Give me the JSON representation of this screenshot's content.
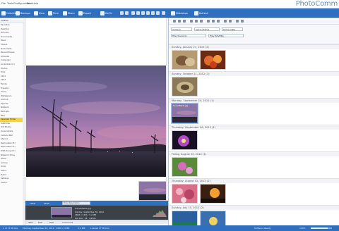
{
  "menubar": {
    "items": [
      "File",
      "Tools",
      "Configuration",
      "Web",
      "Help"
    ],
    "brand": "PhotoComm"
  },
  "toolbar": {
    "buttons": [
      {
        "label": "Collection"
      },
      {
        "label": "Backups"
      },
      {
        "label": "View"
      },
      {
        "label": "Print"
      },
      {
        "label": "Share"
      },
      {
        "label": "Export"
      },
      {
        "label": "Go To"
      },
      {
        "label": "Slideshow"
      },
      {
        "label": "Refresh"
      }
    ]
  },
  "left_panel": {
    "header": "Folders",
    "items": [
      "Favorites",
      "Desktop",
      "Pictures",
      "Documents",
      "Music",
      "Videos",
      "Downloads",
      "Recent Places",
      "Libraries",
      "Computer",
      "Local Disk (C:)",
      "Photos",
      "Trips",
      "2012",
      "2013",
      "Family",
      "Projects",
      "Scans",
      "Wallpapers",
      "Archive",
      "Exports",
      "Network",
      "Backups",
      "Misc",
      "Selected Folder",
      "Subfolder",
      "Old Photos",
      "Screenshots",
      "Camera Roll",
      "Shared",
      "Removable (E:)",
      "Removable (F:)",
      "DVD Drive (D:)",
      "Network Drive",
      "Other",
      "Library",
      "Temp",
      "Users",
      "Public",
      "Settings",
      "Cache"
    ],
    "selected_index": 24
  },
  "viewer": {
    "strip": {
      "title_btn": "TITLE",
      "tags_btn": "TAGS",
      "field_placeholder": "Enter Description"
    },
    "info": {
      "filename": "SunsetFields.jpg",
      "date": "Sunday, September 30, 2012",
      "details": "4608 x 3456  ·  5.2 MB",
      "camera": "ISO 100  ·  f/8  ·  1/250s"
    },
    "tabs": [
      "INFO",
      "EXIF",
      "MAP",
      "Comments"
    ]
  },
  "right_panel": {
    "filters": {
      "type": "All Types",
      "rating": "Sort by Rating",
      "date": "Sort by Date",
      "search": "Filter Keywords",
      "extra": "Filter EPS/JPEG"
    },
    "groups": [
      {
        "date": "Sunday, January 27, 2013",
        "count": "(2)"
      },
      {
        "date": "Sunday, October 21, 2012",
        "count": "(1)"
      },
      {
        "date": "Monday, September 24, 2012",
        "count": "(1)"
      },
      {
        "date": "Thursday, September 06, 2012",
        "count": "(1)"
      },
      {
        "date": "Friday, August 03, 2012",
        "count": "(1)"
      },
      {
        "date": "Thursday, August 02, 2012",
        "count": "(2)"
      },
      {
        "date": "Sunday, July 15, 2012",
        "count": "(2)"
      }
    ],
    "selected_caption": "SunsetFields.jpg"
  },
  "status": {
    "left": "1 of 17 Photos",
    "middle": "Monday, September 24, 2012  ·  4608 x 3456",
    "size": "5.2 MB",
    "loaded": "Loaded 17 Photos",
    "right": "Software Ready",
    "zoom": "100%",
    "progress": 0.8
  },
  "colors": {
    "toolbar": "#2f6fbf",
    "selected_folder": "#f2d24a",
    "brand": "#5a8fc9"
  }
}
